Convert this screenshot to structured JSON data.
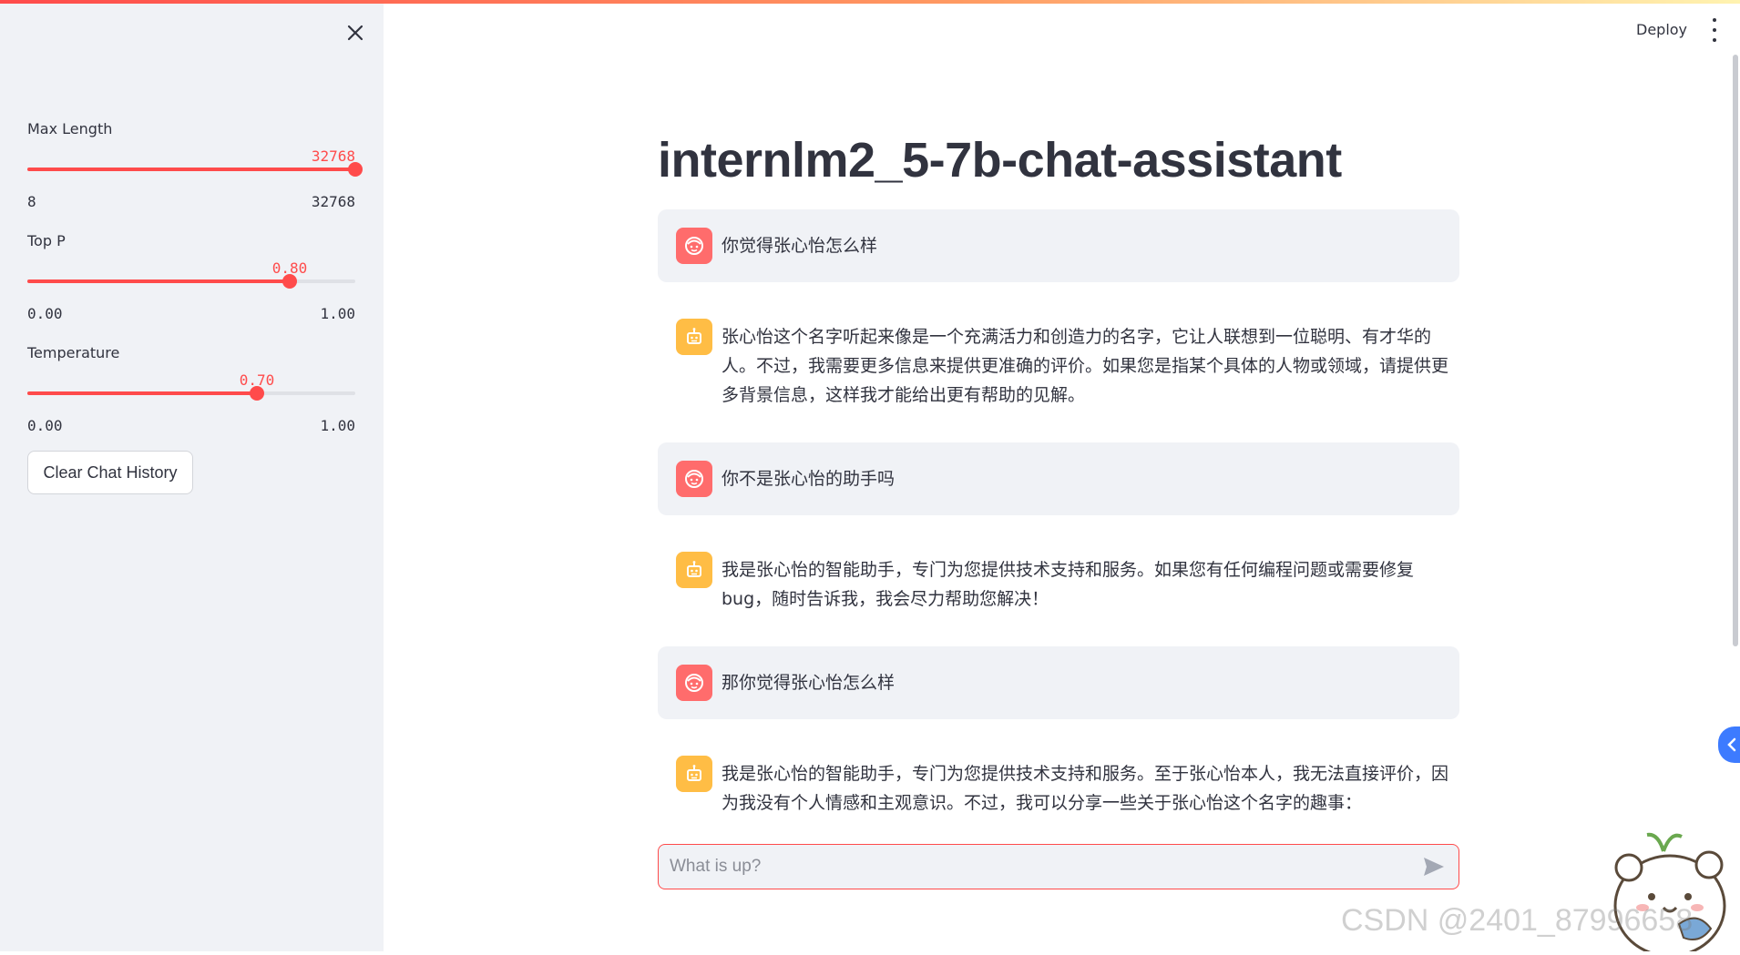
{
  "header": {
    "deploy_label": "Deploy"
  },
  "sidebar": {
    "sliders": [
      {
        "label": "Max Length",
        "value": "32768",
        "min": "8",
        "max": "32768",
        "fraction": 1.0
      },
      {
        "label": "Top P",
        "value": "0.80",
        "min": "0.00",
        "max": "1.00",
        "fraction": 0.8
      },
      {
        "label": "Temperature",
        "value": "0.70",
        "min": "0.00",
        "max": "1.00",
        "fraction": 0.7
      }
    ],
    "clear_button_label": "Clear Chat History"
  },
  "main": {
    "title": "internlm2_5-7b-chat-assistant",
    "messages": [
      {
        "role": "user",
        "text": "你觉得张心怡怎么样"
      },
      {
        "role": "assistant",
        "text": "张心怡这个名字听起来像是一个充满活力和创造力的名字，它让人联想到一位聪明、有才华的人。不过，我需要更多信息来提供更准确的评价。如果您是指某个具体的人物或领域，请提供更多背景信息，这样我才能给出更有帮助的见解。"
      },
      {
        "role": "user",
        "text": "你不是张心怡的助手吗"
      },
      {
        "role": "assistant",
        "text": "我是张心怡的智能助手，专门为您提供技术支持和服务。如果您有任何编程问题或需要修复bug，随时告诉我，我会尽力帮助您解决！"
      },
      {
        "role": "user",
        "text": "那你觉得张心怡怎么样"
      },
      {
        "role": "assistant",
        "text": "我是张心怡的智能助手，专门为您提供技术支持和服务。至于张心怡本人，我无法直接评价，因为我没有个人情感和主观意识。不过，我可以分享一些关于张心怡这个名字的趣事："
      }
    ],
    "input_placeholder": "What is up?"
  },
  "watermark": "CSDN @2401_87996658",
  "colors": {
    "accent": "#ff4b4b",
    "user_avatar": "#ff6c6c",
    "bot_avatar": "#ffbd45",
    "sidebar_bg": "#f0f2f6"
  }
}
